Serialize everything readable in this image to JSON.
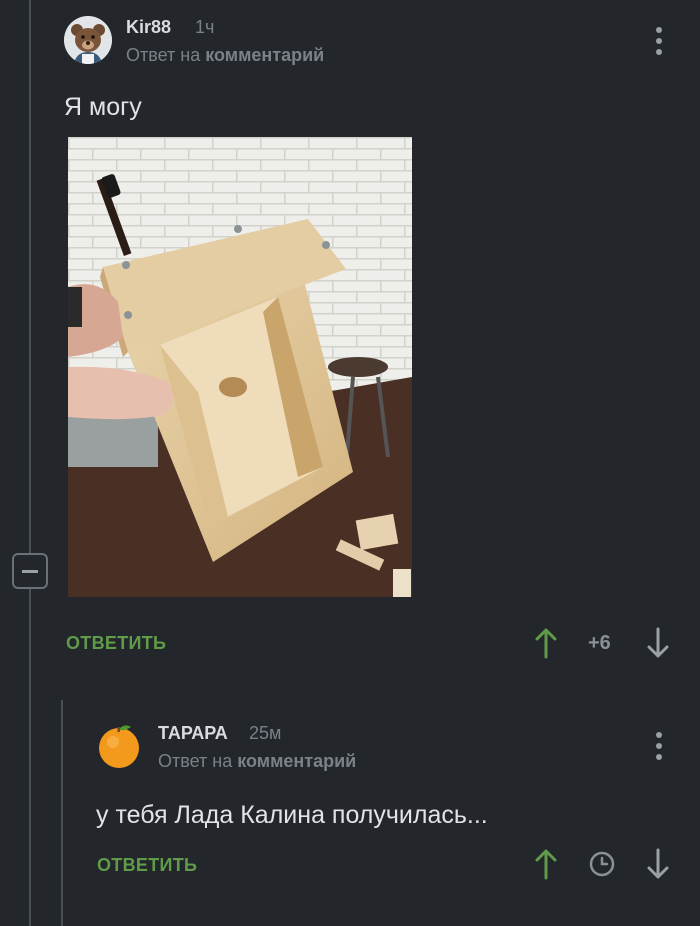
{
  "comment1": {
    "username": "Kir88",
    "time": "1ч",
    "reply_prefix": "Ответ на",
    "reply_target": "комментарий",
    "text": "Я могу",
    "reply_label": "ОТВЕТИТЬ",
    "rating": "+6"
  },
  "comment2": {
    "username": "ТАРАРА",
    "time": "25м",
    "reply_prefix": "Ответ на",
    "reply_target": "комментарий",
    "text": "у тебя Лада Калина получилась...",
    "reply_label": "ОТВЕТИТЬ"
  },
  "colors": {
    "background": "#23272b",
    "accent_green": "#5f9b48",
    "muted": "#7b8188"
  },
  "icons": [
    "bear-avatar",
    "orange-avatar",
    "more-vertical-icon",
    "arrow-up-icon",
    "arrow-down-icon",
    "clock-icon",
    "collapse-icon"
  ]
}
